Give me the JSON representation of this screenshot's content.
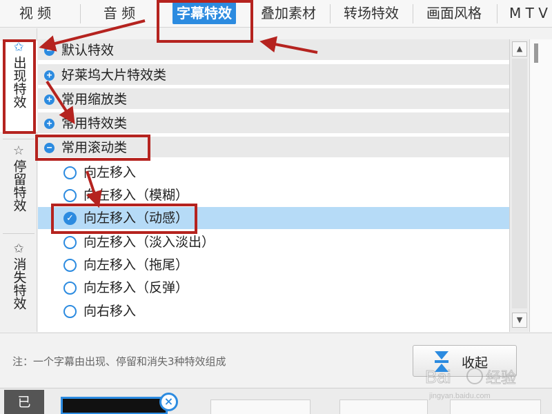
{
  "tabs": [
    {
      "label": "视  频",
      "active": false
    },
    {
      "label": "音  频",
      "active": false
    },
    {
      "label": "字幕特效",
      "active": true
    },
    {
      "label": "叠加素材",
      "active": false
    },
    {
      "label": "转场特效",
      "active": false
    },
    {
      "label": "画面风格",
      "active": false
    },
    {
      "label": "M T V",
      "active": false
    }
  ],
  "side_tabs": [
    {
      "label": "出现特效",
      "icon": "star-add-icon",
      "active": true
    },
    {
      "label": "停留特效",
      "icon": "star-icon",
      "active": false
    },
    {
      "label": "消失特效",
      "icon": "star-remove-icon",
      "active": false
    }
  ],
  "tree": {
    "categories": [
      {
        "label": "默认特效",
        "state": "expanded-partial"
      },
      {
        "label": "好莱坞大片特效类",
        "state": "collapsed"
      },
      {
        "label": "常用缩放类",
        "state": "collapsed"
      },
      {
        "label": "常用特效类",
        "state": "collapsed"
      },
      {
        "label": "常用滚动类",
        "state": "expanded"
      }
    ],
    "items": [
      {
        "label": "向左移入",
        "selected": false
      },
      {
        "label": "向左移入（模糊）",
        "selected": false
      },
      {
        "label": "向左移入（动感）",
        "selected": true
      },
      {
        "label": "向左移入（淡入淡出）",
        "selected": false
      },
      {
        "label": "向左移入（拖尾）",
        "selected": false
      },
      {
        "label": "向左移入（反弹）",
        "selected": false
      },
      {
        "label": "向右移入",
        "selected": false
      }
    ]
  },
  "footer": {
    "note": "注：一个字幕由出现、停留和消失3种特效组成",
    "collapse_label": "收起"
  },
  "bottom": {
    "tab_label": "已"
  },
  "watermark": {
    "brand": "Bai经验",
    "url": "jingyan.baidu.com"
  },
  "colors": {
    "accent": "#2c8be0",
    "selected_row": "#b6dbf7",
    "annotation": "#b5231f"
  }
}
